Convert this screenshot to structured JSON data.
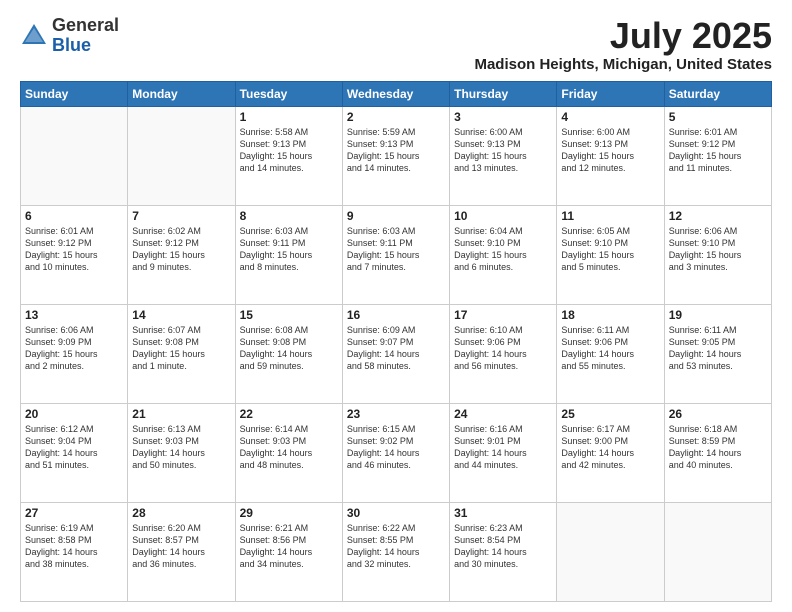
{
  "header": {
    "logo_line1": "General",
    "logo_line2": "Blue",
    "month_year": "July 2025",
    "location": "Madison Heights, Michigan, United States"
  },
  "weekdays": [
    "Sunday",
    "Monday",
    "Tuesday",
    "Wednesday",
    "Thursday",
    "Friday",
    "Saturday"
  ],
  "weeks": [
    [
      {
        "day": "",
        "info": ""
      },
      {
        "day": "",
        "info": ""
      },
      {
        "day": "1",
        "info": "Sunrise: 5:58 AM\nSunset: 9:13 PM\nDaylight: 15 hours\nand 14 minutes."
      },
      {
        "day": "2",
        "info": "Sunrise: 5:59 AM\nSunset: 9:13 PM\nDaylight: 15 hours\nand 14 minutes."
      },
      {
        "day": "3",
        "info": "Sunrise: 6:00 AM\nSunset: 9:13 PM\nDaylight: 15 hours\nand 13 minutes."
      },
      {
        "day": "4",
        "info": "Sunrise: 6:00 AM\nSunset: 9:13 PM\nDaylight: 15 hours\nand 12 minutes."
      },
      {
        "day": "5",
        "info": "Sunrise: 6:01 AM\nSunset: 9:12 PM\nDaylight: 15 hours\nand 11 minutes."
      }
    ],
    [
      {
        "day": "6",
        "info": "Sunrise: 6:01 AM\nSunset: 9:12 PM\nDaylight: 15 hours\nand 10 minutes."
      },
      {
        "day": "7",
        "info": "Sunrise: 6:02 AM\nSunset: 9:12 PM\nDaylight: 15 hours\nand 9 minutes."
      },
      {
        "day": "8",
        "info": "Sunrise: 6:03 AM\nSunset: 9:11 PM\nDaylight: 15 hours\nand 8 minutes."
      },
      {
        "day": "9",
        "info": "Sunrise: 6:03 AM\nSunset: 9:11 PM\nDaylight: 15 hours\nand 7 minutes."
      },
      {
        "day": "10",
        "info": "Sunrise: 6:04 AM\nSunset: 9:10 PM\nDaylight: 15 hours\nand 6 minutes."
      },
      {
        "day": "11",
        "info": "Sunrise: 6:05 AM\nSunset: 9:10 PM\nDaylight: 15 hours\nand 5 minutes."
      },
      {
        "day": "12",
        "info": "Sunrise: 6:06 AM\nSunset: 9:10 PM\nDaylight: 15 hours\nand 3 minutes."
      }
    ],
    [
      {
        "day": "13",
        "info": "Sunrise: 6:06 AM\nSunset: 9:09 PM\nDaylight: 15 hours\nand 2 minutes."
      },
      {
        "day": "14",
        "info": "Sunrise: 6:07 AM\nSunset: 9:08 PM\nDaylight: 15 hours\nand 1 minute."
      },
      {
        "day": "15",
        "info": "Sunrise: 6:08 AM\nSunset: 9:08 PM\nDaylight: 14 hours\nand 59 minutes."
      },
      {
        "day": "16",
        "info": "Sunrise: 6:09 AM\nSunset: 9:07 PM\nDaylight: 14 hours\nand 58 minutes."
      },
      {
        "day": "17",
        "info": "Sunrise: 6:10 AM\nSunset: 9:06 PM\nDaylight: 14 hours\nand 56 minutes."
      },
      {
        "day": "18",
        "info": "Sunrise: 6:11 AM\nSunset: 9:06 PM\nDaylight: 14 hours\nand 55 minutes."
      },
      {
        "day": "19",
        "info": "Sunrise: 6:11 AM\nSunset: 9:05 PM\nDaylight: 14 hours\nand 53 minutes."
      }
    ],
    [
      {
        "day": "20",
        "info": "Sunrise: 6:12 AM\nSunset: 9:04 PM\nDaylight: 14 hours\nand 51 minutes."
      },
      {
        "day": "21",
        "info": "Sunrise: 6:13 AM\nSunset: 9:03 PM\nDaylight: 14 hours\nand 50 minutes."
      },
      {
        "day": "22",
        "info": "Sunrise: 6:14 AM\nSunset: 9:03 PM\nDaylight: 14 hours\nand 48 minutes."
      },
      {
        "day": "23",
        "info": "Sunrise: 6:15 AM\nSunset: 9:02 PM\nDaylight: 14 hours\nand 46 minutes."
      },
      {
        "day": "24",
        "info": "Sunrise: 6:16 AM\nSunset: 9:01 PM\nDaylight: 14 hours\nand 44 minutes."
      },
      {
        "day": "25",
        "info": "Sunrise: 6:17 AM\nSunset: 9:00 PM\nDaylight: 14 hours\nand 42 minutes."
      },
      {
        "day": "26",
        "info": "Sunrise: 6:18 AM\nSunset: 8:59 PM\nDaylight: 14 hours\nand 40 minutes."
      }
    ],
    [
      {
        "day": "27",
        "info": "Sunrise: 6:19 AM\nSunset: 8:58 PM\nDaylight: 14 hours\nand 38 minutes."
      },
      {
        "day": "28",
        "info": "Sunrise: 6:20 AM\nSunset: 8:57 PM\nDaylight: 14 hours\nand 36 minutes."
      },
      {
        "day": "29",
        "info": "Sunrise: 6:21 AM\nSunset: 8:56 PM\nDaylight: 14 hours\nand 34 minutes."
      },
      {
        "day": "30",
        "info": "Sunrise: 6:22 AM\nSunset: 8:55 PM\nDaylight: 14 hours\nand 32 minutes."
      },
      {
        "day": "31",
        "info": "Sunrise: 6:23 AM\nSunset: 8:54 PM\nDaylight: 14 hours\nand 30 minutes."
      },
      {
        "day": "",
        "info": ""
      },
      {
        "day": "",
        "info": ""
      }
    ]
  ]
}
